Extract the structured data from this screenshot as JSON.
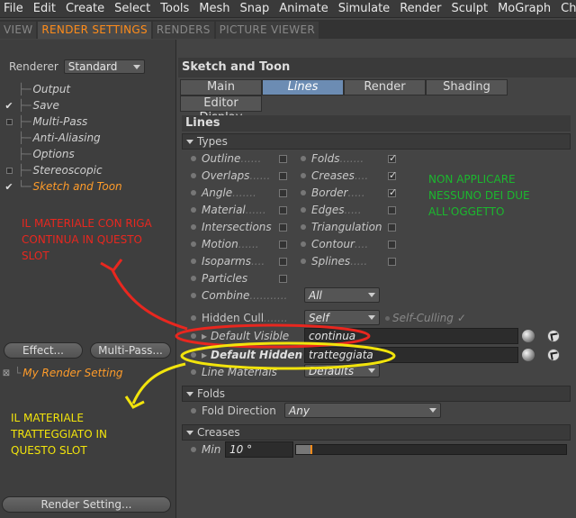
{
  "menubar": [
    "File",
    "Edit",
    "Create",
    "Select",
    "Tools",
    "Mesh",
    "Snap",
    "Animate",
    "Simulate",
    "Render",
    "Sculpt",
    "MoGraph",
    "Charac"
  ],
  "tabs": [
    {
      "label": "VIEW",
      "active": false
    },
    {
      "label": "RENDER SETTINGS",
      "active": true
    },
    {
      "label": "RENDERS",
      "active": false
    },
    {
      "label": "PICTURE VIEWER",
      "active": false
    }
  ],
  "left": {
    "renderer_label": "Renderer",
    "renderer_value": "Standard",
    "tree": [
      {
        "label": "Output",
        "check": "none"
      },
      {
        "label": "Save",
        "check": "on"
      },
      {
        "label": "Multi-Pass",
        "check": "box"
      },
      {
        "label": "Anti-Aliasing",
        "check": "none"
      },
      {
        "label": "Options",
        "check": "none"
      },
      {
        "label": "Stereoscopic",
        "check": "box"
      },
      {
        "label": "Sketch and Toon",
        "check": "on",
        "selected": true
      }
    ],
    "effect_button": "Effect...",
    "multipass_button": "Multi-Pass...",
    "my_render_setting": "My Render Setting",
    "render_setting_button": "Render Setting..."
  },
  "right": {
    "header": "Sketch and Toon",
    "subtabs": [
      {
        "label": "Main",
        "active": false
      },
      {
        "label": "Lines",
        "active": true
      },
      {
        "label": "Render",
        "active": false
      },
      {
        "label": "Shading",
        "active": false
      },
      {
        "label": "Editor Display",
        "active": false
      }
    ],
    "lines_title": "Lines",
    "types_header": "Types",
    "types_left": [
      {
        "label": "Outline",
        "dots": "......",
        "checked": false
      },
      {
        "label": "Overlaps",
        "dots": "......",
        "checked": false
      },
      {
        "label": "Angle",
        "dots": ".......",
        "checked": false
      },
      {
        "label": "Material",
        "dots": "......",
        "checked": false
      },
      {
        "label": "Intersections",
        "dots": "",
        "checked": false
      },
      {
        "label": "Motion",
        "dots": "......",
        "checked": false
      },
      {
        "label": "Isoparms",
        "dots": "....",
        "checked": false
      },
      {
        "label": "Particles",
        "dots": "",
        "checked": false
      }
    ],
    "types_right": [
      {
        "label": "Folds",
        "dots": ".......",
        "checked": true
      },
      {
        "label": "Creases",
        "dots": "....",
        "checked": true
      },
      {
        "label": "Border",
        "dots": ".....",
        "checked": true
      },
      {
        "label": "Edges",
        "dots": ".....",
        "checked": false
      },
      {
        "label": "Triangulation",
        "dots": "",
        "checked": false
      },
      {
        "label": "Contour",
        "dots": "....",
        "checked": false
      },
      {
        "label": "Splines",
        "dots": ".....",
        "checked": false
      }
    ],
    "combine_label": "Combine",
    "combine_dots": "...........",
    "combine_value": "All",
    "hidden_cull_label": "Hidden Cull",
    "hidden_cull_dots": ".......",
    "hidden_cull_value": "Self",
    "self_culling_label": "Self-Culling",
    "default_visible_label": "Default Visible",
    "default_visible_value": "continua",
    "default_hidden_label": "Default Hidden",
    "default_hidden_value": "tratteggiata",
    "line_materials_label": "Line Materials",
    "line_materials_value": "Defaults",
    "folds_header": "Folds",
    "fold_direction_label": "Fold Direction",
    "fold_direction_value": "Any",
    "creases_header": "Creases",
    "min_label": "Min",
    "min_value": "10 °"
  },
  "annotations": {
    "red_text": "IL MATERIALE CON RIGA\nCONTINUA IN QUESTO\nSLOT",
    "yellow_text": "IL MATERIALE\nTRATTEGGIATO IN\nQUESTO SLOT",
    "green_text": "NON APPLICARE\nNESSUNO DEI DUE\nALL'OGGETTO",
    "red_color": "#e8271f",
    "yellow_color": "#f2e40c",
    "green_color": "#1bb82e"
  },
  "colors": {
    "accent": "#ff8c1a",
    "active_tab": "#6c8cb3",
    "panel": "#444444"
  }
}
